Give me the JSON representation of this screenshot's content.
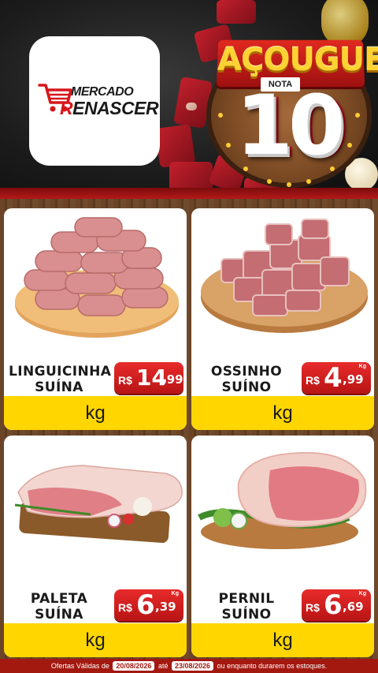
{
  "brand": {
    "line1": "MERCADO",
    "line2_first": "R",
    "line2_rest": "ENASCER"
  },
  "campaign": {
    "title": "AÇOUGUE",
    "subtitle": "NOTA",
    "score": "10"
  },
  "products": [
    {
      "name_line1": "LINGUICINHA",
      "name_line2": "SUÍNA",
      "currency": "R$",
      "price_int": "14",
      "price_dec": ",99",
      "price_unit_small": "",
      "unit": "kg"
    },
    {
      "name_line1": "OSSINHO",
      "name_line2": "SUÍNO",
      "currency": "R$",
      "price_int": "4",
      "price_dec": ",99",
      "price_unit_small": "Kg",
      "unit": "kg"
    },
    {
      "name_line1": "PALETA",
      "name_line2": "SUÍNA",
      "currency": "R$",
      "price_int": "6",
      "price_dec": ",39",
      "price_unit_small": "Kg",
      "unit": "kg"
    },
    {
      "name_line1": "PERNIL",
      "name_line2": "SUÍNO",
      "currency": "R$",
      "price_int": "6",
      "price_dec": ",69",
      "price_unit_small": "Kg",
      "unit": "kg"
    }
  ],
  "footer": {
    "prefix": "Ofertas Válidas de",
    "start_date": "20/08/2026",
    "middle": "até",
    "end_date": "23/08/2026",
    "suffix": "ou enquanto durarem os estoques."
  },
  "colors": {
    "accent_red": "#d6171b",
    "price_red": "#e82b2b",
    "unit_yellow": "#ffd600",
    "footer_red": "#a3180f"
  }
}
